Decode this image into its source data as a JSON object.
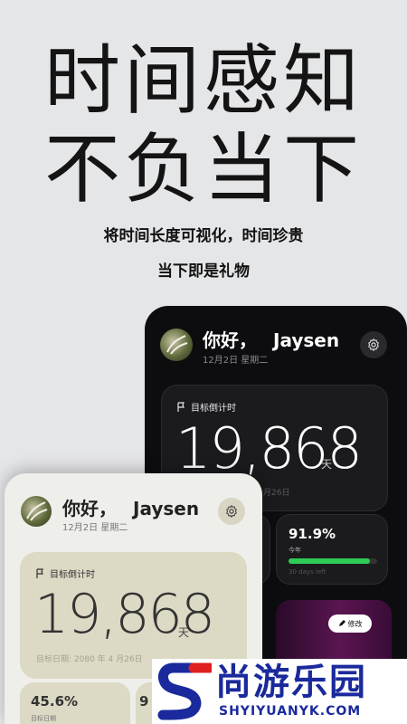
{
  "hero": {
    "line1": "时间感知",
    "line2": "不负当下",
    "sub1": "将时间长度可视化，时间珍贵",
    "sub2": "当下即是礼物"
  },
  "dark_app": {
    "greeting": "你好，",
    "user": "Jaysen",
    "date": "12月2日 星期二",
    "countdown_label": "目标倒计时",
    "countdown_value": "19,868",
    "countdown_unit": "天",
    "target_date_partial": "月26日",
    "stat_year": {
      "percent": "91.9%",
      "label": "今年",
      "left": "30 days left",
      "fill": 0.919
    },
    "edit_label": "修改"
  },
  "light_app": {
    "greeting": "你好，",
    "user": "Jaysen",
    "date": "12月2日 星期二",
    "countdown_label": "目标倒计时",
    "countdown_value": "19,868",
    "countdown_unit": "天",
    "target_date": "目标日期: 2080 年 4 月26日",
    "stat_left": {
      "percent": "45.6%",
      "label": "目标日期"
    },
    "stat_right_partial": "9"
  },
  "watermark": {
    "title": "尚游乐园",
    "url": "SHYIYUANYK.COM"
  },
  "colors": {
    "background": "#e5e6e8",
    "dark_bg": "#0d0d10",
    "light_bg": "#eeeeea",
    "olive_panel": "#dcd9c4",
    "progress_green": "#2ecc55",
    "watermark_blue": "#1a2a9c"
  }
}
